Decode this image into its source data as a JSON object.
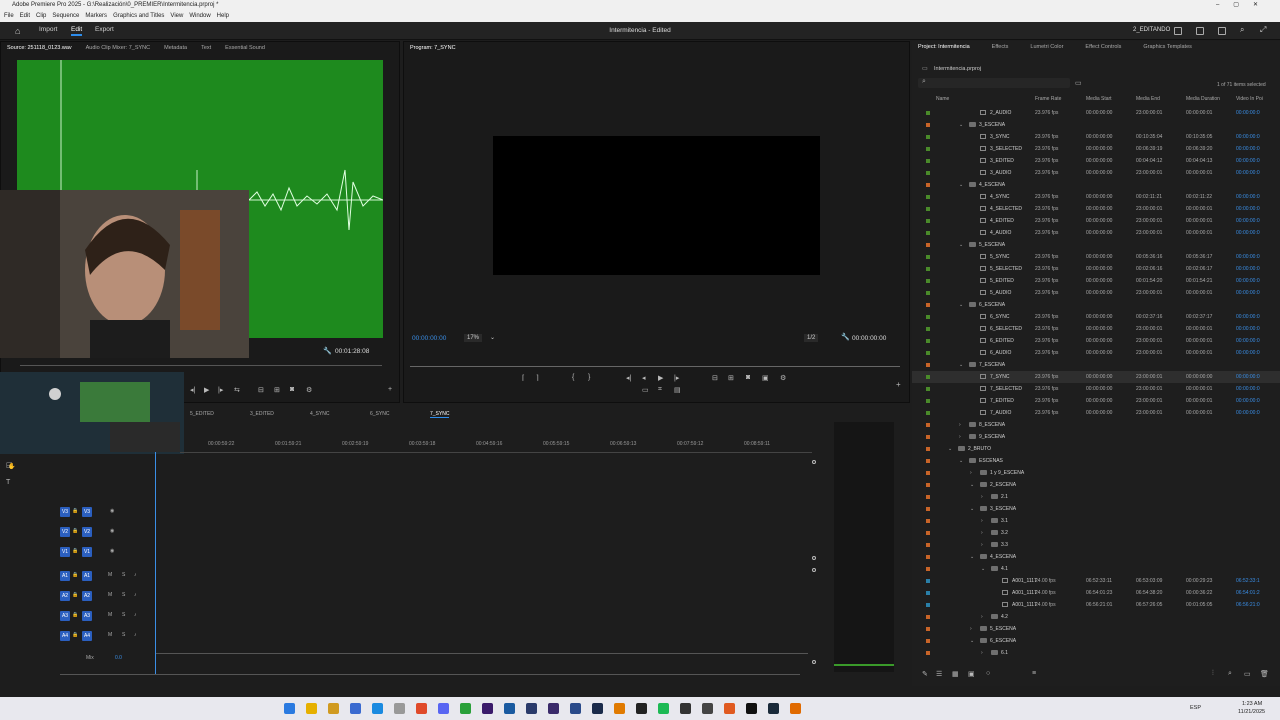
{
  "window": {
    "title": "Adobe Premiere Pro 2025 - G:\\Realización\\0_PREMIER\\Intermitencia.prproj *",
    "menu": [
      "File",
      "Edit",
      "Clip",
      "Sequence",
      "Markers",
      "Graphics and Titles",
      "View",
      "Window",
      "Help"
    ]
  },
  "topbar": {
    "tabs": [
      "Import",
      "Edit",
      "Export"
    ],
    "active_tab": "Edit",
    "project_title": "Intermitencia - Edited",
    "workspace": "2_EDITANDO"
  },
  "source_panel": {
    "tabs": [
      "Source: 251118_0123.wav",
      "Audio Clip Mixer: 7_SYNC",
      "Metadata",
      "Text",
      "Essential Sound"
    ],
    "duration": "00:01:28:08"
  },
  "program_panel": {
    "tab": "Program: 7_SYNC",
    "timecode": "00:00:00:00",
    "zoom": "17%",
    "resolution": "1/2",
    "end_timecode": "00:00:00:00"
  },
  "project_panel": {
    "tabs": [
      "Project: Intermitencia",
      "Effects",
      "Lumetri Color",
      "Effect Controls",
      "Graphics Templates"
    ],
    "project_file": "Intermitencia.prproj",
    "selection": "1 of 71 items selected",
    "columns": [
      "Name",
      "Frame Rate",
      "Media Start",
      "Media End",
      "Media Duration",
      "Video In Poi"
    ],
    "rows": [
      {
        "indent": 2,
        "kind": "item",
        "name": "2_AUDIO",
        "fps": "23.976 fps",
        "start": "00:00:00:00",
        "end": "23:00:00:01",
        "dur": "00:00:00:01",
        "vin": "00:00:00:0",
        "chip": "#4a8a2a"
      },
      {
        "indent": 1,
        "kind": "folder",
        "name": "3_ESCENA",
        "chip": "#c86428"
      },
      {
        "indent": 2,
        "kind": "item",
        "name": "3_SYNC",
        "fps": "23.976 fps",
        "start": "00:00:00:00",
        "end": "00:10:35:04",
        "dur": "00:10:35:05",
        "vin": "00:00:00:0",
        "chip": "#4a8a2a"
      },
      {
        "indent": 2,
        "kind": "item",
        "name": "3_SELECTED",
        "fps": "23.976 fps",
        "start": "00:00:00:00",
        "end": "00:06:39:19",
        "dur": "00:06:39:20",
        "vin": "00:00:00:0",
        "chip": "#4a8a2a"
      },
      {
        "indent": 2,
        "kind": "item",
        "name": "3_EDITED",
        "fps": "23.976 fps",
        "start": "00:00:00:00",
        "end": "00:04:04:12",
        "dur": "00:04:04:13",
        "vin": "00:00:00:0",
        "chip": "#4a8a2a"
      },
      {
        "indent": 2,
        "kind": "item",
        "name": "3_AUDIO",
        "fps": "23.976 fps",
        "start": "00:00:00:00",
        "end": "23:00:00:01",
        "dur": "00:00:00:01",
        "vin": "00:00:00:0",
        "chip": "#4a8a2a"
      },
      {
        "indent": 1,
        "kind": "folder",
        "name": "4_ESCENA",
        "chip": "#c86428"
      },
      {
        "indent": 2,
        "kind": "item",
        "name": "4_SYNC",
        "fps": "23.976 fps",
        "start": "00:00:00:00",
        "end": "00:02:11:21",
        "dur": "00:02:11:22",
        "vin": "00:00:00:0",
        "chip": "#4a8a2a"
      },
      {
        "indent": 2,
        "kind": "item",
        "name": "4_SELECTED",
        "fps": "23.976 fps",
        "start": "00:00:00:00",
        "end": "23:00:00:01",
        "dur": "00:00:00:01",
        "vin": "00:00:00:0",
        "chip": "#4a8a2a"
      },
      {
        "indent": 2,
        "kind": "item",
        "name": "4_EDITED",
        "fps": "23.976 fps",
        "start": "00:00:00:00",
        "end": "23:00:00:01",
        "dur": "00:00:00:01",
        "vin": "00:00:00:0",
        "chip": "#4a8a2a"
      },
      {
        "indent": 2,
        "kind": "item",
        "name": "4_AUDIO",
        "fps": "23.976 fps",
        "start": "00:00:00:00",
        "end": "23:00:00:01",
        "dur": "00:00:00:01",
        "vin": "00:00:00:0",
        "chip": "#4a8a2a"
      },
      {
        "indent": 1,
        "kind": "folder",
        "name": "5_ESCENA",
        "chip": "#c86428"
      },
      {
        "indent": 2,
        "kind": "item",
        "name": "5_SYNC",
        "fps": "23.976 fps",
        "start": "00:00:00:00",
        "end": "00:05:36:16",
        "dur": "00:05:36:17",
        "vin": "00:00:00:0",
        "chip": "#4a8a2a"
      },
      {
        "indent": 2,
        "kind": "item",
        "name": "5_SELECTED",
        "fps": "23.976 fps",
        "start": "00:00:00:00",
        "end": "00:02:06:16",
        "dur": "00:02:06:17",
        "vin": "00:00:00:0",
        "chip": "#4a8a2a"
      },
      {
        "indent": 2,
        "kind": "item",
        "name": "5_EDITED",
        "fps": "23.976 fps",
        "start": "00:00:00:00",
        "end": "00:01:54:20",
        "dur": "00:01:54:21",
        "vin": "00:00:00:0",
        "chip": "#4a8a2a"
      },
      {
        "indent": 2,
        "kind": "item",
        "name": "5_AUDIO",
        "fps": "23.976 fps",
        "start": "00:00:00:00",
        "end": "23:00:00:01",
        "dur": "00:00:00:01",
        "vin": "00:00:00:0",
        "chip": "#4a8a2a"
      },
      {
        "indent": 1,
        "kind": "folder",
        "name": "6_ESCENA",
        "chip": "#c86428"
      },
      {
        "indent": 2,
        "kind": "item",
        "name": "6_SYNC",
        "fps": "23.976 fps",
        "start": "00:00:00:00",
        "end": "00:02:37:16",
        "dur": "00:02:37:17",
        "vin": "00:00:00:0",
        "chip": "#4a8a2a"
      },
      {
        "indent": 2,
        "kind": "item",
        "name": "6_SELECTED",
        "fps": "23.976 fps",
        "start": "00:00:00:00",
        "end": "23:00:00:01",
        "dur": "00:00:00:01",
        "vin": "00:00:00:0",
        "chip": "#4a8a2a"
      },
      {
        "indent": 2,
        "kind": "item",
        "name": "6_EDITED",
        "fps": "23.976 fps",
        "start": "00:00:00:00",
        "end": "23:00:00:01",
        "dur": "00:00:00:01",
        "vin": "00:00:00:0",
        "chip": "#4a8a2a"
      },
      {
        "indent": 2,
        "kind": "item",
        "name": "6_AUDIO",
        "fps": "23.976 fps",
        "start": "00:00:00:00",
        "end": "23:00:00:01",
        "dur": "00:00:00:01",
        "vin": "00:00:00:0",
        "chip": "#4a8a2a"
      },
      {
        "indent": 1,
        "kind": "folder",
        "name": "7_ESCENA",
        "chip": "#c86428"
      },
      {
        "indent": 2,
        "kind": "item",
        "name": "7_SYNC",
        "fps": "23.976 fps",
        "start": "00:00:00:00",
        "end": "23:00:00:01",
        "dur": "00:00:00:00",
        "vin": "00:00:00:0",
        "chip": "#4a8a2a",
        "selected": true
      },
      {
        "indent": 2,
        "kind": "item",
        "name": "7_SELECTED",
        "fps": "23.976 fps",
        "start": "00:00:00:00",
        "end": "23:00:00:01",
        "dur": "00:00:00:01",
        "vin": "00:00:00:0",
        "chip": "#4a8a2a"
      },
      {
        "indent": 2,
        "kind": "item",
        "name": "7_EDITED",
        "fps": "23.976 fps",
        "start": "00:00:00:00",
        "end": "23:00:00:01",
        "dur": "00:00:00:01",
        "vin": "00:00:00:0",
        "chip": "#4a8a2a"
      },
      {
        "indent": 2,
        "kind": "item",
        "name": "7_AUDIO",
        "fps": "23.976 fps",
        "start": "00:00:00:00",
        "end": "23:00:00:01",
        "dur": "00:00:00:01",
        "vin": "00:00:00:0",
        "chip": "#4a8a2a"
      },
      {
        "indent": 1,
        "kind": "folder-closed",
        "name": "8_ESCENA",
        "chip": "#c86428"
      },
      {
        "indent": 1,
        "kind": "folder-closed",
        "name": "9_ESCENA",
        "chip": "#c86428"
      },
      {
        "indent": 0,
        "kind": "folder",
        "name": "2_BRUTO",
        "chip": "#c86428"
      },
      {
        "indent": 1,
        "kind": "folder",
        "name": "ESCENAS",
        "chip": "#c86428"
      },
      {
        "indent": 2,
        "kind": "folder-closed",
        "name": "1 y 9_ESCENA",
        "chip": "#c86428"
      },
      {
        "indent": 2,
        "kind": "folder",
        "name": "2_ESCENA",
        "chip": "#c86428"
      },
      {
        "indent": 3,
        "kind": "folder-closed",
        "name": "2.1",
        "chip": "#c86428"
      },
      {
        "indent": 2,
        "kind": "folder",
        "name": "3_ESCENA",
        "chip": "#c86428"
      },
      {
        "indent": 3,
        "kind": "folder-closed",
        "name": "3.1",
        "chip": "#c86428"
      },
      {
        "indent": 3,
        "kind": "folder-closed",
        "name": "3.2",
        "chip": "#c86428"
      },
      {
        "indent": 3,
        "kind": "folder-closed",
        "name": "3.3",
        "chip": "#c86428"
      },
      {
        "indent": 2,
        "kind": "folder",
        "name": "4_ESCENA",
        "chip": "#c86428"
      },
      {
        "indent": 3,
        "kind": "folder",
        "name": "4.1",
        "chip": "#c86428"
      },
      {
        "indent": 4,
        "kind": "item",
        "name": "A001_1117",
        "fps": "24.00 fps",
        "start": "06:52:33:11",
        "end": "06:53:03:09",
        "dur": "00:00:29:23",
        "vin": "06:52:33:1",
        "chip": "#2a7fa8"
      },
      {
        "indent": 4,
        "kind": "item",
        "name": "A001_1117",
        "fps": "24.00 fps",
        "start": "06:54:01:23",
        "end": "06:54:38:20",
        "dur": "00:00:36:22",
        "vin": "06:54:01:2",
        "chip": "#2a7fa8"
      },
      {
        "indent": 4,
        "kind": "item",
        "name": "A001_1117",
        "fps": "24.00 fps",
        "start": "06:56:21:01",
        "end": "06:57:26:05",
        "dur": "00:01:05:05",
        "vin": "06:56:21:0",
        "chip": "#2a7fa8"
      },
      {
        "indent": 3,
        "kind": "folder-closed",
        "name": "4.2",
        "chip": "#c86428"
      },
      {
        "indent": 2,
        "kind": "folder-closed",
        "name": "5_ESCENA",
        "chip": "#c86428"
      },
      {
        "indent": 2,
        "kind": "folder",
        "name": "6_ESCENA",
        "chip": "#c86428"
      },
      {
        "indent": 3,
        "kind": "folder-closed",
        "name": "6.1",
        "chip": "#c86428"
      }
    ]
  },
  "timeline": {
    "sequence_tabs": [
      "5_EDITED",
      "3_EDITED",
      "4_SYNC",
      "6_SYNC",
      "7_SYNC"
    ],
    "active_sequence": "7_SYNC",
    "ruler": [
      "00:00:59:22",
      "00:01:59:21",
      "00:02:59:19",
      "00:03:59:18",
      "00:04:59:16",
      "00:05:59:15",
      "00:06:59:13",
      "00:07:59:12",
      "00:08:59:11"
    ],
    "video_tracks": [
      "V3",
      "V2",
      "V1"
    ],
    "audio_tracks": [
      "A1",
      "A2",
      "A3",
      "A4"
    ],
    "mix_label": "Mix",
    "mix_value": "0.0"
  },
  "taskbar": {
    "language": "ESP",
    "time": "1:23 AM",
    "date": "11/21/2025"
  }
}
